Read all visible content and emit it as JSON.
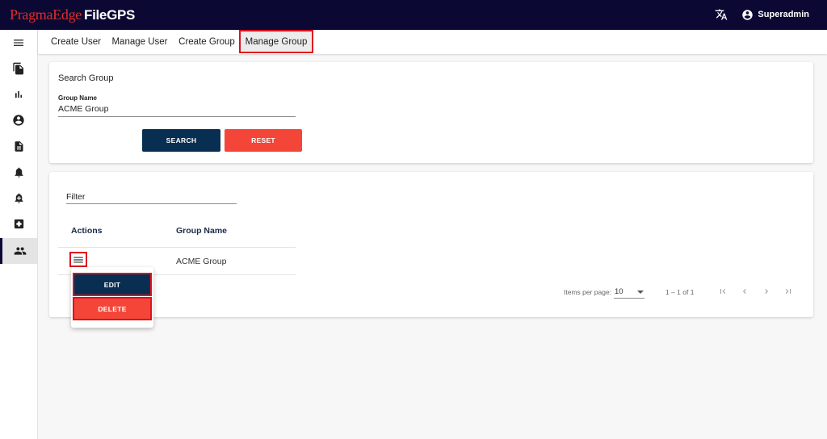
{
  "header": {
    "brand_primary": "PragmaEdge",
    "brand_secondary": "FileGPS",
    "translate_icon": "translate-icon",
    "user_icon": "account-circle-icon",
    "username": "Superadmin"
  },
  "sidebar": {
    "items": [
      {
        "icon": "menu-icon"
      },
      {
        "icon": "file-copy-icon"
      },
      {
        "icon": "bar-chart-icon"
      },
      {
        "icon": "account-circle-icon"
      },
      {
        "icon": "description-icon"
      },
      {
        "icon": "bell-icon"
      },
      {
        "icon": "bell-plus-icon"
      },
      {
        "icon": "medical-box-icon"
      },
      {
        "icon": "group-icon",
        "active": true
      }
    ]
  },
  "tabs": [
    {
      "label": "Create User"
    },
    {
      "label": "Manage User"
    },
    {
      "label": "Create Group"
    },
    {
      "label": "Manage Group",
      "active": true
    }
  ],
  "search": {
    "title": "Search Group",
    "field_label": "Group Name",
    "field_value": "ACME Group",
    "search_label": "SEARCH",
    "reset_label": "RESET"
  },
  "results": {
    "filter_label": "Filter",
    "columns": [
      "Actions",
      "Group Name"
    ],
    "rows": [
      {
        "group_name": "ACME Group"
      }
    ],
    "menu": {
      "edit_label": "EDIT",
      "delete_label": "DELETE"
    },
    "paginator": {
      "items_per_page_label": "Items per page:",
      "page_size": "10",
      "range_label": "1 – 1 of 1"
    }
  },
  "colors": {
    "topbar": "#0b0933",
    "brand_red": "#e32b2b",
    "navy_button": "#082f52",
    "red_button": "#f34638",
    "highlight": "#e0101e"
  }
}
